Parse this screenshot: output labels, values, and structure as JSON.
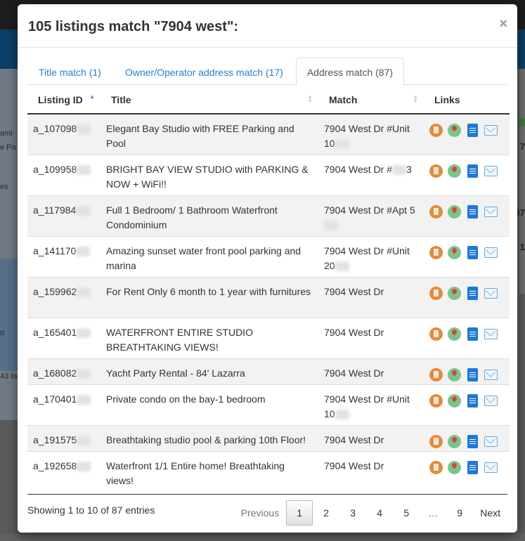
{
  "background": {
    "map_labels": [
      "ami",
      "e Pa",
      "es",
      "d",
      "43 lis"
    ],
    "right_values": [
      "7",
      "87",
      "1"
    ]
  },
  "modal": {
    "title": "105 listings match \"7904 west\":",
    "close_label": "×",
    "tabs": [
      {
        "label": "Title match (1)",
        "active": false
      },
      {
        "label": "Owner/Operator address match (17)",
        "active": false
      },
      {
        "label": "Address match (87)",
        "active": true
      }
    ],
    "columns": [
      "Listing ID",
      "Title",
      "Match",
      "Links"
    ],
    "rows": [
      {
        "id": "a_107098",
        "title": "Elegant Bay Studio with FREE Parking and Pool",
        "match": "7904 West Dr #Unit 10"
      },
      {
        "id": "a_109958",
        "title": "BRIGHT BAY VIEW STUDIO with PARKING & NOW + WiFi!!",
        "match": "7904 West Dr #",
        "match_suffix": "3"
      },
      {
        "id": "a_117984",
        "title": "Full 1 Bedroom/ 1 Bathroom Waterfront Condominium",
        "match": "7904 West Dr #Apt 5"
      },
      {
        "id": "a_141170",
        "title": "Amazing sunset water front pool parking and marina",
        "match": "7904 West Dr #Unit 20"
      },
      {
        "id": "a_159962",
        "title": "For Rent Only 6 month to 1 year with furnitures",
        "match": "7904 West Dr"
      },
      {
        "id": "a_165401",
        "title": "WATERFRONT ENTIRE STUDIO BREATHTAKING VIEWS!",
        "match": "7904 West Dr"
      },
      {
        "id": "a_168082",
        "title": "Yacht Party Rental - 84' Lazarra",
        "match": "7904 West Dr"
      },
      {
        "id": "a_170401",
        "title": "Private condo on the bay-1 bedroom",
        "match": "7904 West Dr #Unit 10"
      },
      {
        "id": "a_191575",
        "title": "Breathtaking studio pool & parking 10th Floor!",
        "match": "7904 West Dr"
      },
      {
        "id": "a_192658",
        "title": "Waterfront 1/1 Entire home! Breathtaking views!",
        "match": "7904 West Dr"
      }
    ],
    "icons": [
      "clipboard-icon",
      "map-pin-icon",
      "document-icon",
      "mail-icon"
    ],
    "footer": {
      "info": "Showing 1 to 10 of 87 entries",
      "previous": "Previous",
      "next": "Next",
      "pages": [
        "1",
        "2",
        "3",
        "4",
        "5",
        "…",
        "9"
      ],
      "current_page": "1"
    }
  }
}
